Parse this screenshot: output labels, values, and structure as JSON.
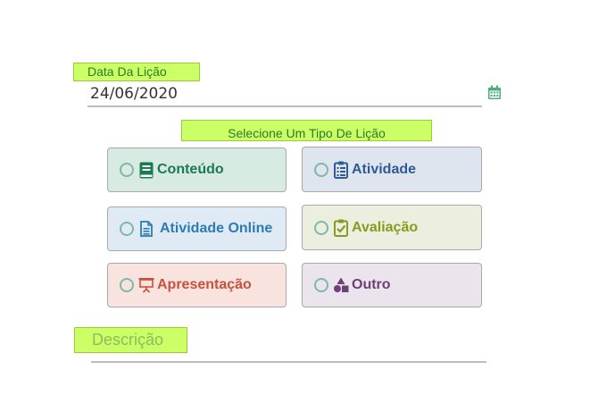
{
  "date_field": {
    "label": "Data Da Lição",
    "value": "24/06/2020",
    "icon": "calendar-icon"
  },
  "lesson_type": {
    "label": "Selecione Um Tipo De Lição",
    "options": [
      {
        "label": "Conteúdo",
        "icon": "book-icon",
        "color": "#1a7a52",
        "selected": false
      },
      {
        "label": "Atividade",
        "icon": "clipboard-list-icon",
        "color": "#2e5b94",
        "selected": false
      },
      {
        "label": "Atividade Online",
        "icon": "document-icon",
        "color": "#2b7bb5",
        "selected": false
      },
      {
        "label": "Avaliação",
        "icon": "clipboard-check-icon",
        "color": "#8a9a1e",
        "selected": false
      },
      {
        "label": "Apresentação",
        "icon": "presentation-icon",
        "color": "#c9503a",
        "selected": false
      },
      {
        "label": "Outro",
        "icon": "shapes-icon",
        "color": "#6e3f7a",
        "selected": false
      }
    ]
  },
  "description_field": {
    "placeholder": "Descrição"
  },
  "colors": {
    "label_highlight": "#ccff66",
    "calendar_icon": "#4caf7d"
  }
}
